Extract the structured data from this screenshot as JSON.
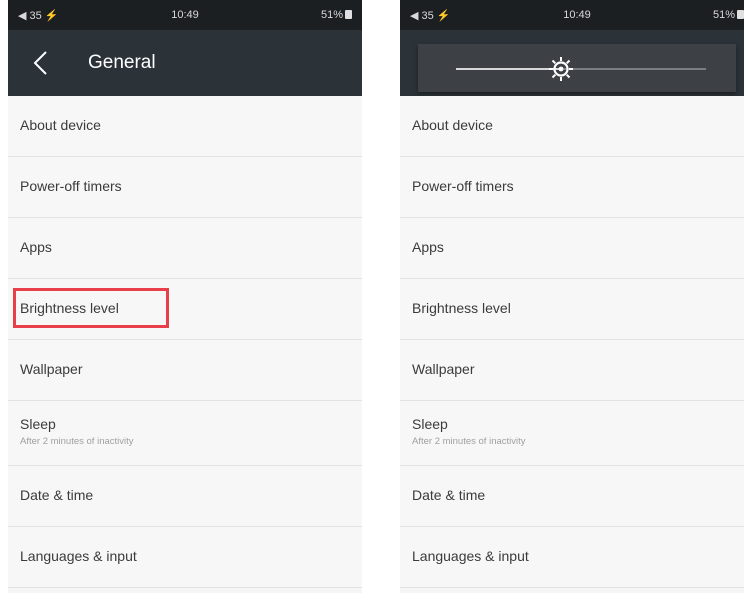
{
  "status_bar": {
    "left": "◀ 35 ⚡",
    "time": "10:49",
    "battery": "51%"
  },
  "left_screen": {
    "title": "General"
  },
  "brightness": {
    "level": 0.42
  },
  "menu": {
    "items": [
      {
        "label": "About device"
      },
      {
        "label": "Power-off timers"
      },
      {
        "label": "Apps"
      },
      {
        "label": "Brightness level"
      },
      {
        "label": "Wallpaper"
      },
      {
        "label": "Sleep",
        "subtitle": "After 2 minutes of inactivity"
      },
      {
        "label": "Date & time"
      },
      {
        "label": "Languages & input"
      }
    ]
  },
  "colors": {
    "app_bar": "#2b3238",
    "status_bar": "#1c1f22",
    "highlight": "#e8404a"
  },
  "icons": [
    "back-arrow-icon",
    "brightness-sun-icon",
    "battery-icon"
  ]
}
